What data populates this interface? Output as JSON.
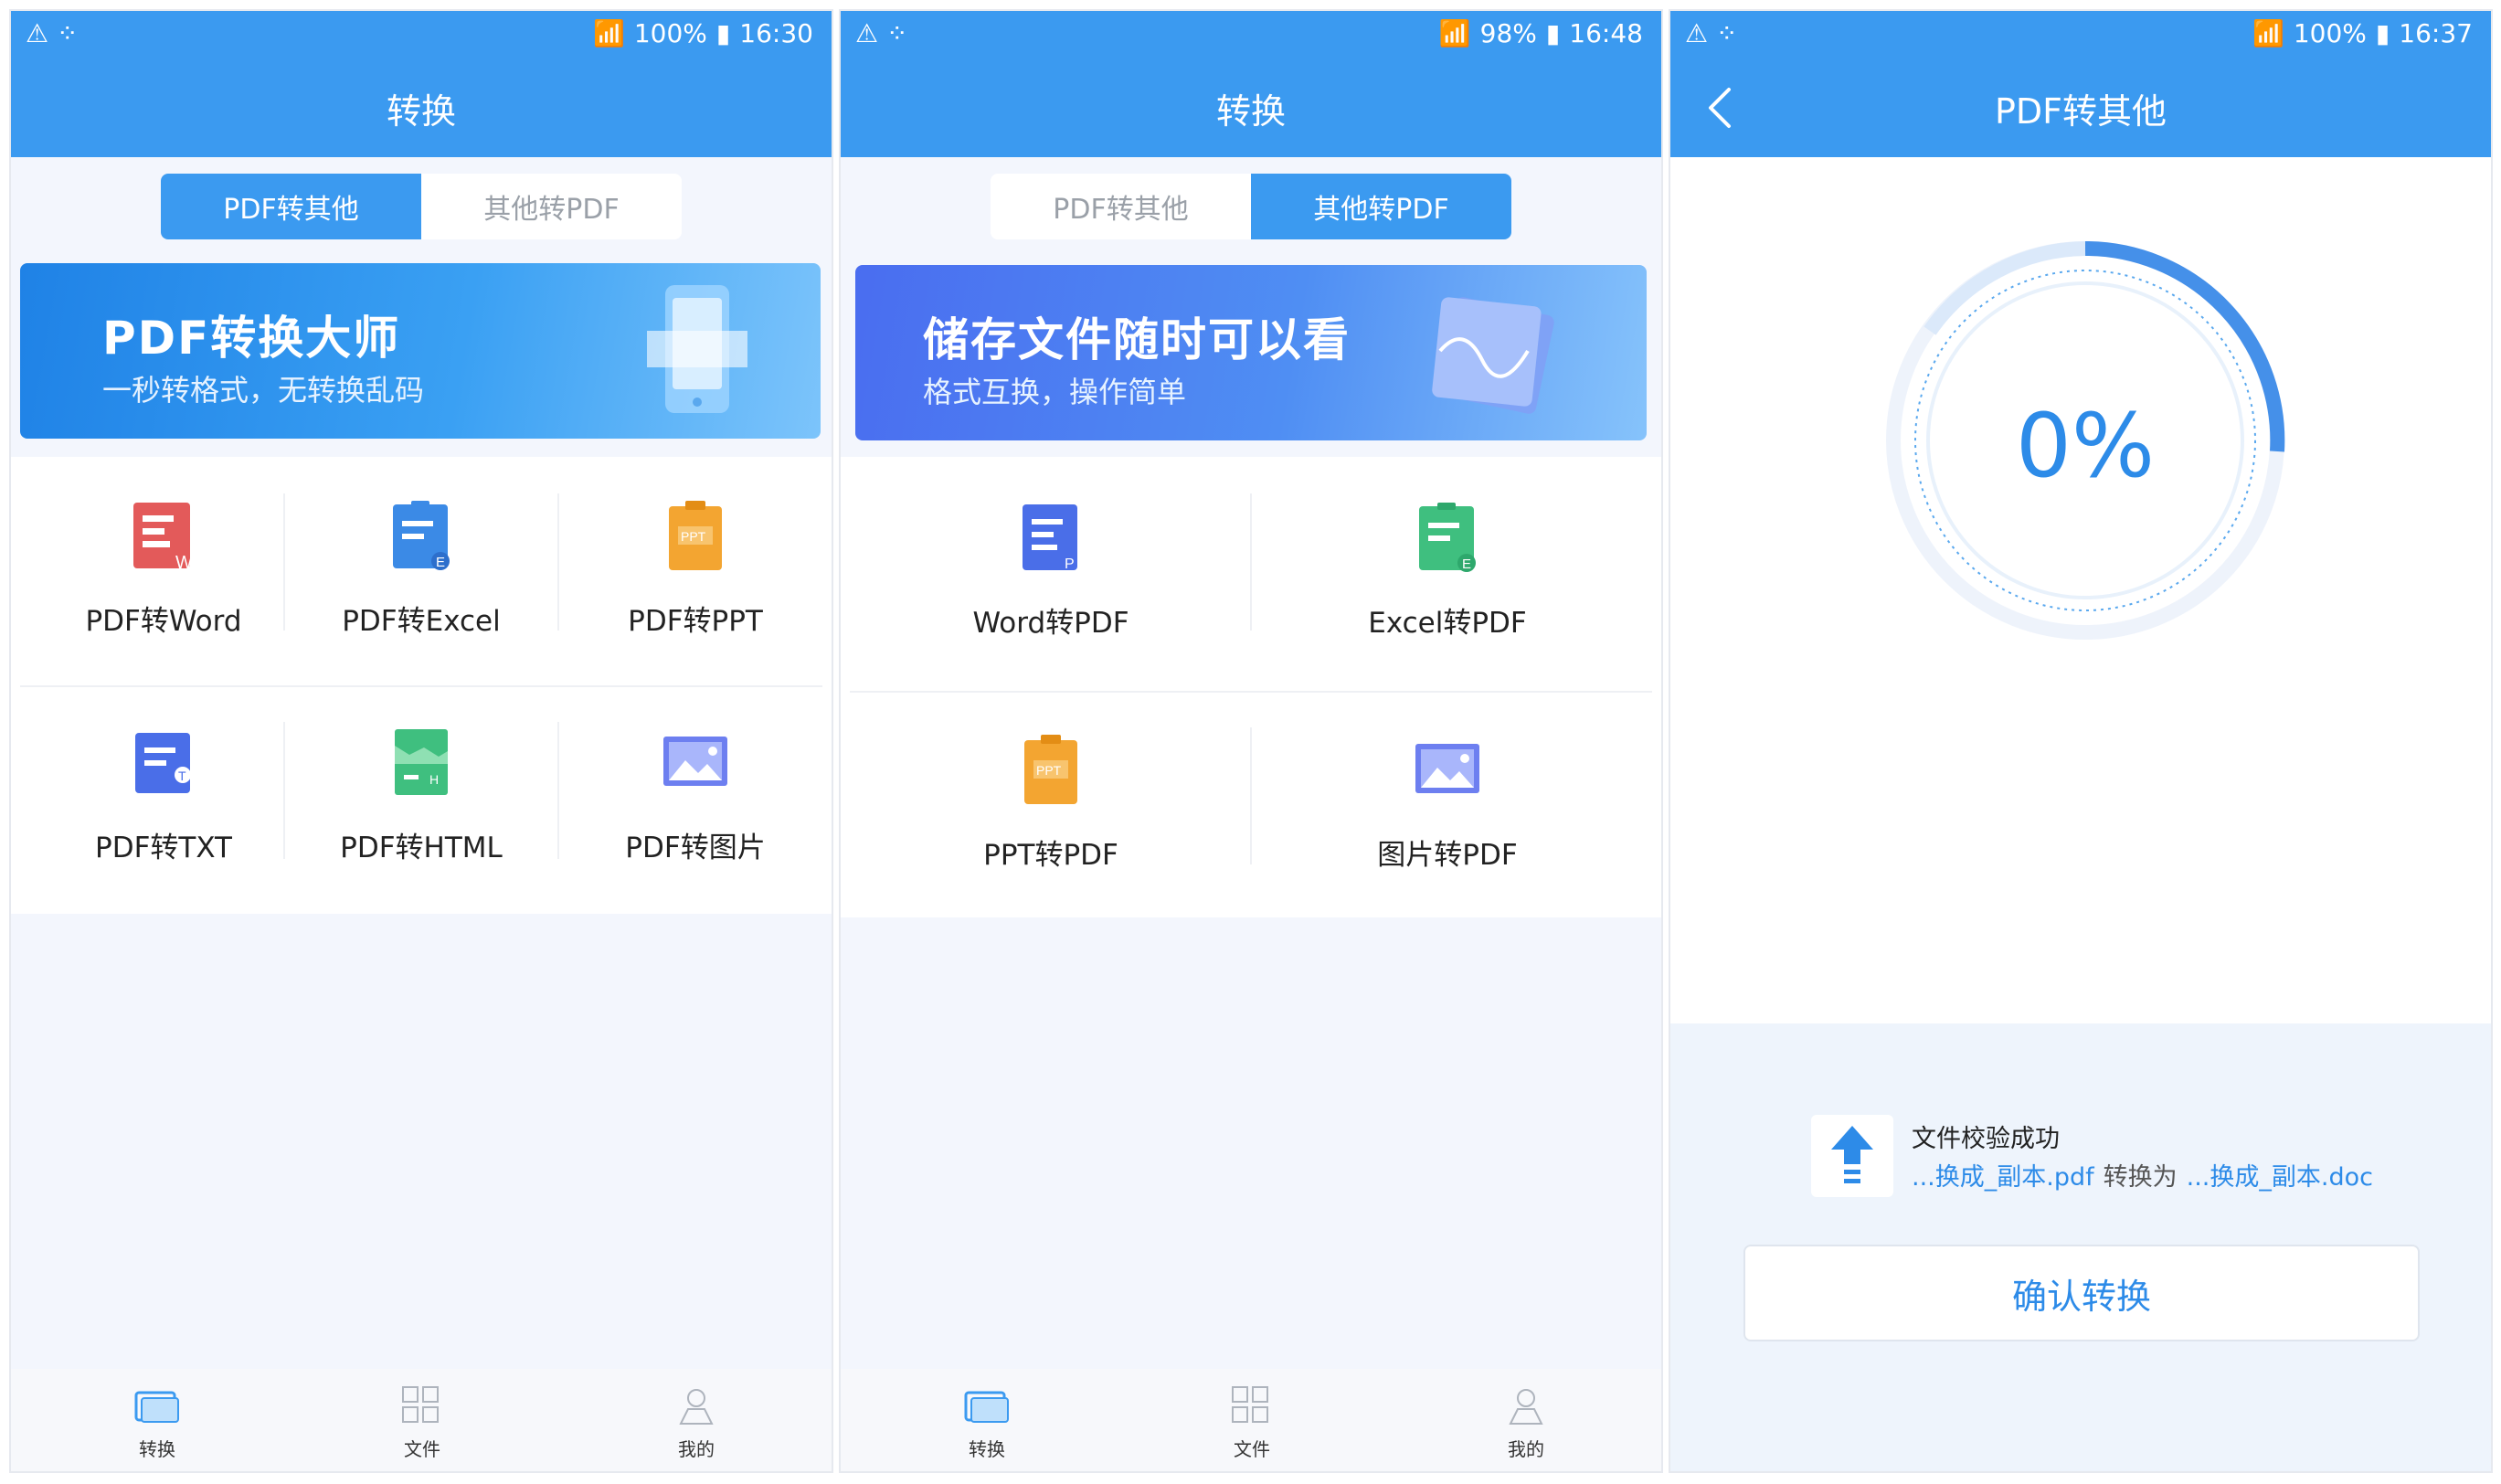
{
  "screens": [
    {
      "status": {
        "time": "16:30",
        "battery": "100%"
      },
      "title": "转换",
      "segment": {
        "left": "PDF转其他",
        "right": "其他转PDF",
        "active": "left"
      },
      "banner": {
        "title": "PDF转换大师",
        "subtitle": "一秒转格式，无转换乱码"
      },
      "tools": [
        {
          "label": "PDF转Word",
          "icon": "word-doc-icon"
        },
        {
          "label": "PDF转Excel",
          "icon": "excel-doc-icon"
        },
        {
          "label": "PDF转PPT",
          "icon": "ppt-doc-icon"
        },
        {
          "label": "PDF转TXT",
          "icon": "txt-doc-icon"
        },
        {
          "label": "PDF转HTML",
          "icon": "html-doc-icon"
        },
        {
          "label": "PDF转图片",
          "icon": "image-icon"
        }
      ],
      "tabbar": [
        {
          "label": "转换",
          "icon": "convert-tab-icon",
          "active": true
        },
        {
          "label": "文件",
          "icon": "files-tab-icon",
          "active": false
        },
        {
          "label": "我的",
          "icon": "profile-tab-icon",
          "active": false
        }
      ]
    },
    {
      "status": {
        "time": "16:48",
        "battery": "98%"
      },
      "title": "转换",
      "segment": {
        "left": "PDF转其他",
        "right": "其他转PDF",
        "active": "right"
      },
      "banner": {
        "title": "储存文件随时可以看",
        "subtitle": "格式互换，操作简单"
      },
      "tools": [
        {
          "label": "Word转PDF",
          "icon": "word-doc-icon"
        },
        {
          "label": "Excel转PDF",
          "icon": "excel-doc-icon"
        },
        {
          "label": "PPT转PDF",
          "icon": "ppt-doc-icon"
        },
        {
          "label": "图片转PDF",
          "icon": "image-icon"
        }
      ],
      "tabbar": [
        {
          "label": "转换",
          "icon": "convert-tab-icon",
          "active": true
        },
        {
          "label": "文件",
          "icon": "files-tab-icon",
          "active": false
        },
        {
          "label": "我的",
          "icon": "profile-tab-icon",
          "active": false
        }
      ]
    },
    {
      "status": {
        "time": "16:37",
        "battery": "100%"
      },
      "title": "PDF转其他",
      "progress": {
        "percent_text": "0%",
        "value": 0
      },
      "file": {
        "status": "文件校验成功",
        "source": "...换成_副本.pdf",
        "convert_to": "转换为",
        "target": "...换成_副本.doc"
      },
      "confirm_label": "确认转换"
    }
  ],
  "colors": {
    "primary": "#3b9af0",
    "accent_text": "#2d8be8",
    "background": "#f3f6fd"
  }
}
